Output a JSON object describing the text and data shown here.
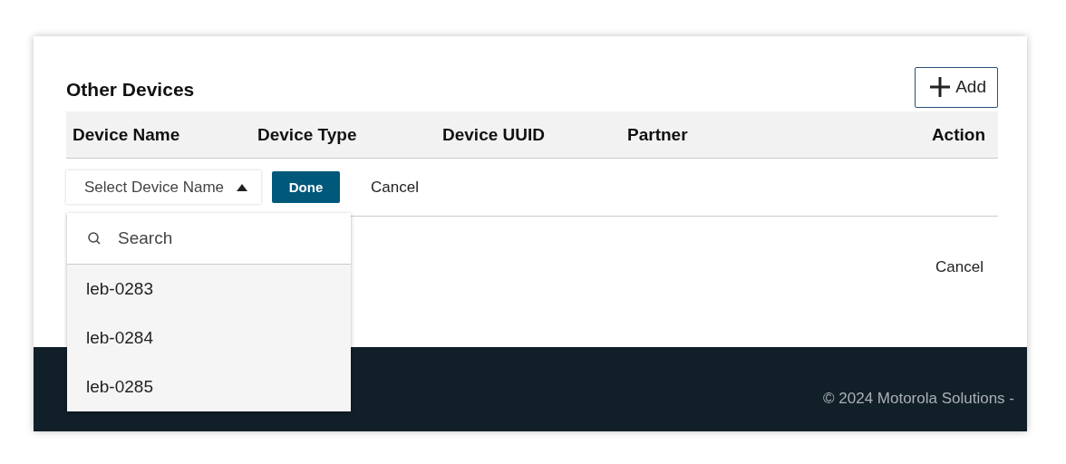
{
  "section": {
    "title": "Other Devices",
    "add_button": "Add"
  },
  "table": {
    "columns": [
      "Device Name",
      "Device Type",
      "Device UUID",
      "Partner",
      "Action"
    ],
    "edit_row": {
      "select": {
        "placeholder": "Select Device Name",
        "expanded": true
      },
      "done_button": "Done",
      "cancel_button": "Cancel"
    },
    "row_2": {
      "cancel_button": "Cancel"
    }
  },
  "dropdown": {
    "search": {
      "placeholder": "Search"
    },
    "options": [
      "leb-0283",
      "leb-0284",
      "leb-0285"
    ]
  },
  "footer": {
    "copyright": "© 2024 Motorola Solutions -"
  }
}
